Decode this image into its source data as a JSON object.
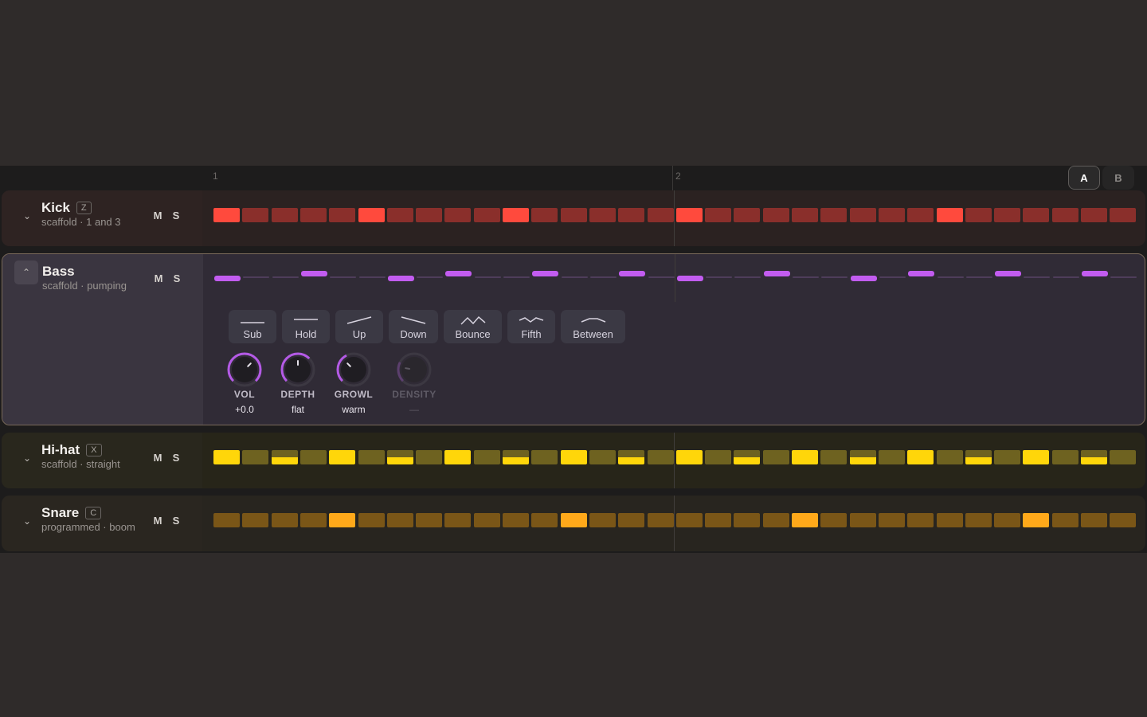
{
  "ruler": {
    "bar_1": "1",
    "bar_2": "2"
  },
  "pattern_buttons": {
    "a": "A",
    "b": "B",
    "selected": "A"
  },
  "tracks": {
    "kick": {
      "name": "Kick",
      "key": "Z",
      "subtitle": "scaffold · 1 and 3",
      "mute": "M",
      "solo": "S",
      "on_color": "#ff4a3d",
      "off_color": "#8a2f2b",
      "bg": "#2e2322",
      "steps": [
        1,
        0,
        0,
        0,
        0,
        1,
        0,
        0,
        0,
        0,
        1,
        0,
        0,
        0,
        0,
        0,
        1,
        0,
        0,
        0,
        0,
        0,
        0,
        0,
        0,
        1,
        0,
        0,
        0,
        0,
        0,
        0
      ]
    },
    "bass": {
      "name": "Bass",
      "subtitle": "scaffold · pumping",
      "mute": "M",
      "solo": "S",
      "on_color": "#c25cf0",
      "off_color": "#4e3d5a",
      "notes": [
        {
          "active": true,
          "level": "low"
        },
        {
          "active": false
        },
        {
          "active": false
        },
        {
          "active": true,
          "level": "high"
        },
        {
          "active": false
        },
        {
          "active": false
        },
        {
          "active": true,
          "level": "low"
        },
        {
          "active": false
        },
        {
          "active": true,
          "level": "high"
        },
        {
          "active": false
        },
        {
          "active": false
        },
        {
          "active": true,
          "level": "high"
        },
        {
          "active": false
        },
        {
          "active": false
        },
        {
          "active": true,
          "level": "high"
        },
        {
          "active": false
        },
        {
          "active": true,
          "level": "low"
        },
        {
          "active": false
        },
        {
          "active": false
        },
        {
          "active": true,
          "level": "high"
        },
        {
          "active": false
        },
        {
          "active": false
        },
        {
          "active": true,
          "level": "low"
        },
        {
          "active": false
        },
        {
          "active": true,
          "level": "high"
        },
        {
          "active": false
        },
        {
          "active": false
        },
        {
          "active": true,
          "level": "high"
        },
        {
          "active": false
        },
        {
          "active": false
        },
        {
          "active": true,
          "level": "high"
        },
        {
          "active": false
        }
      ],
      "shapes": [
        "Sub",
        "Hold",
        "Up",
        "Down",
        "Bounce",
        "Fifth",
        "Between"
      ],
      "knobs": [
        {
          "label": "VOL",
          "value": "+0.0",
          "enabled": true
        },
        {
          "label": "DEPTH",
          "value": "flat",
          "enabled": true
        },
        {
          "label": "GROWL",
          "value": "warm",
          "enabled": true
        },
        {
          "label": "DENSITY",
          "value": "—",
          "enabled": false
        }
      ]
    },
    "hihat": {
      "name": "Hi-hat",
      "key": "X",
      "subtitle": "scaffold · straight",
      "mute": "M",
      "solo": "S",
      "on_color": "#ffd60a",
      "off_color": "#6e6220",
      "bg": "#28261e",
      "steps": [
        1,
        0,
        2,
        0,
        1,
        0,
        2,
        0,
        1,
        0,
        2,
        0,
        1,
        0,
        2,
        0,
        1,
        0,
        2,
        0,
        1,
        0,
        2,
        0,
        1,
        0,
        2,
        0,
        1,
        0,
        2,
        0
      ]
    },
    "snare": {
      "name": "Snare",
      "key": "C",
      "subtitle": "programmed · boom bap",
      "mute": "M",
      "solo": "S",
      "on_color": "#ffa91a",
      "off_color": "#7a5617",
      "bg": "#2a2620",
      "steps": [
        0,
        0,
        0,
        0,
        1,
        0,
        0,
        0,
        0,
        0,
        0,
        0,
        1,
        0,
        0,
        0,
        0,
        0,
        0,
        0,
        1,
        0,
        0,
        0,
        0,
        0,
        0,
        0,
        1,
        0,
        0,
        0
      ]
    }
  }
}
